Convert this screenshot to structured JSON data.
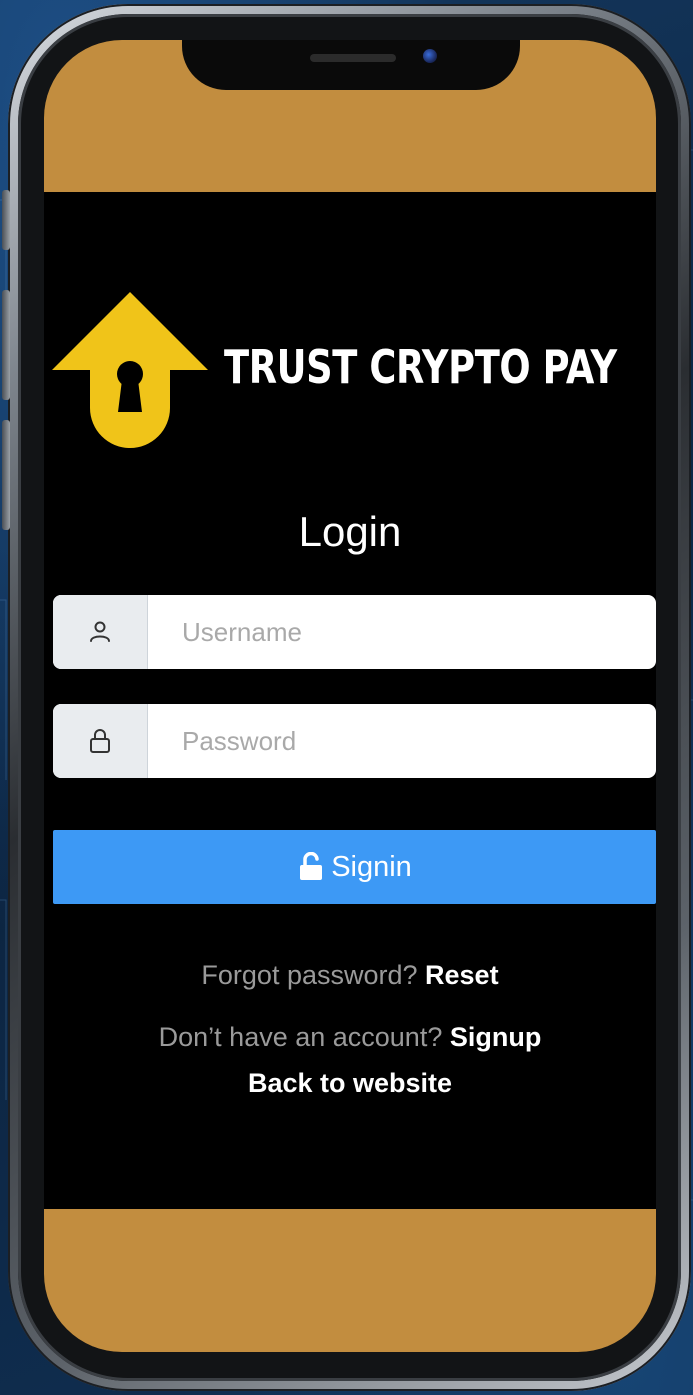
{
  "brand": {
    "name": "TRUST CRYPTO PAY",
    "logo_icon": "house-keyhole-icon",
    "colors": {
      "logo_yellow": "#f0c419",
      "band": "#c28d3f",
      "screen_bg": "#000000",
      "button": "#3d99f5"
    }
  },
  "login": {
    "title": "Login",
    "username": {
      "icon": "user-icon",
      "placeholder": "Username",
      "value": ""
    },
    "password": {
      "icon": "lock-icon",
      "placeholder": "Password",
      "value": ""
    },
    "signin_icon": "unlock-icon",
    "signin_label": "Signin"
  },
  "links": {
    "forgot_prompt": "Forgot password?",
    "reset_label": "Reset",
    "signup_prompt": "Don’t have an account?",
    "signup_label": "Signup",
    "back_label": "Back to website"
  }
}
